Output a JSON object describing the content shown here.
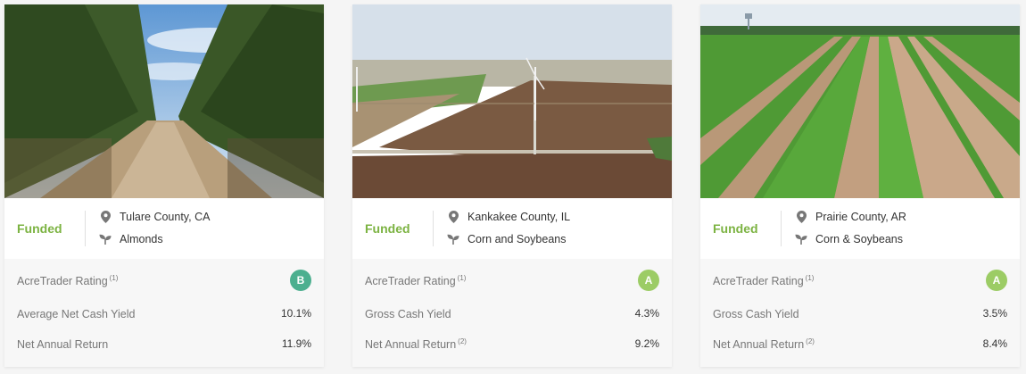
{
  "colors": {
    "funded": "#7cb342",
    "badge_b": "#4caf8f",
    "badge_a": "#9ccc65"
  },
  "cards": [
    {
      "status": "Funded",
      "location": "Tulare County, CA",
      "crop": "Almonds",
      "image_icon": "almond-orchard-photo",
      "rating_label": "AcreTrader Rating",
      "rating_sup": "(1)",
      "rating": "B",
      "stat1_label": "Average Net Cash Yield",
      "stat1_sup": "",
      "stat1_value": "10.1%",
      "stat2_label": "Net Annual Return",
      "stat2_sup": "",
      "stat2_value": "11.9%"
    },
    {
      "status": "Funded",
      "location": "Kankakee County, IL",
      "crop": "Corn and Soybeans",
      "image_icon": "farmland-wind-turbines-photo",
      "rating_label": "AcreTrader Rating",
      "rating_sup": "(1)",
      "rating": "A",
      "stat1_label": "Gross Cash Yield",
      "stat1_sup": "",
      "stat1_value": "4.3%",
      "stat2_label": "Net Annual Return",
      "stat2_sup": "(2)",
      "stat2_value": "9.2%"
    },
    {
      "status": "Funded",
      "location": "Prairie County, AR",
      "crop": "Corn & Soybeans",
      "image_icon": "soybean-rows-photo",
      "rating_label": "AcreTrader Rating",
      "rating_sup": "(1)",
      "rating": "A",
      "stat1_label": "Gross Cash Yield",
      "stat1_sup": "",
      "stat1_value": "3.5%",
      "stat2_label": "Net Annual Return",
      "stat2_sup": "(2)",
      "stat2_value": "8.4%"
    }
  ]
}
